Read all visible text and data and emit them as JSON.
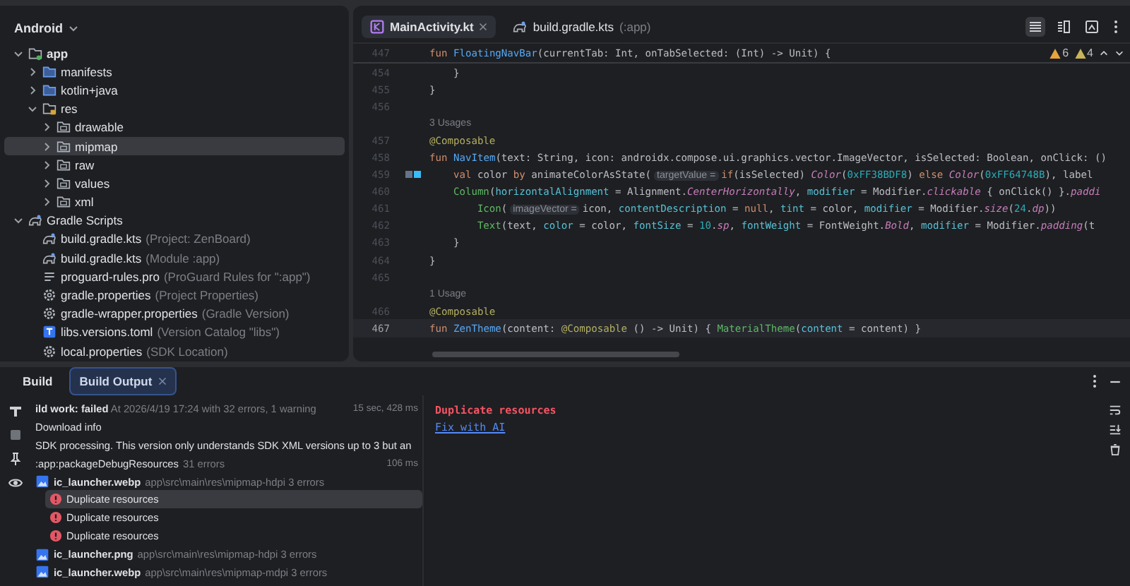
{
  "project_panel": {
    "title": "Android",
    "tree": [
      {
        "label": "app",
        "kind": "module",
        "expanded": true,
        "selected": false,
        "children": [
          {
            "label": "manifests",
            "kind": "folder",
            "expanded": false,
            "selected": false
          },
          {
            "label": "kotlin+java",
            "kind": "folder",
            "expanded": false,
            "selected": false
          },
          {
            "label": "res",
            "kind": "res",
            "expanded": true,
            "selected": false,
            "children": [
              {
                "label": "drawable",
                "kind": "subfolder",
                "expanded": false,
                "selected": false
              },
              {
                "label": "mipmap",
                "kind": "subfolder",
                "expanded": false,
                "selected": true
              },
              {
                "label": "raw",
                "kind": "subfolder",
                "expanded": false,
                "selected": false
              },
              {
                "label": "values",
                "kind": "subfolder",
                "expanded": false,
                "selected": false
              },
              {
                "label": "xml",
                "kind": "subfolder",
                "expanded": false,
                "selected": false
              }
            ]
          }
        ]
      },
      {
        "label": "Gradle Scripts",
        "kind": "gradle",
        "expanded": true,
        "selected": false,
        "children": [
          {
            "label": "build.gradle.kts",
            "hint": "(Project: ZenBoard)",
            "kind": "gradle",
            "selected": false
          },
          {
            "label": "build.gradle.kts",
            "hint": "(Module :app)",
            "kind": "gradle",
            "selected": false
          },
          {
            "label": "proguard-rules.pro",
            "hint": "(ProGuard Rules for \":app\")",
            "kind": "lines",
            "selected": false
          },
          {
            "label": "gradle.properties",
            "hint": "(Project Properties)",
            "kind": "gear",
            "selected": false
          },
          {
            "label": "gradle-wrapper.properties",
            "hint": "(Gradle Version)",
            "kind": "gear",
            "selected": false
          },
          {
            "label": "libs.versions.toml",
            "hint": "(Version Catalog \"libs\")",
            "kind": "toml",
            "selected": false
          },
          {
            "label": "local.properties",
            "hint": "(SDK Location)",
            "kind": "gear",
            "selected": false
          }
        ]
      }
    ]
  },
  "editor": {
    "tabs": [
      {
        "label": "MainActivity.kt",
        "kind": "kotlin",
        "selected": true,
        "closable": true
      },
      {
        "label": "build.gradle.kts",
        "hint": "(:app)",
        "kind": "gradle",
        "selected": false,
        "closable": false
      }
    ],
    "view_modes": [
      {
        "kind": "code",
        "selected": true
      },
      {
        "kind": "split",
        "selected": false
      },
      {
        "kind": "design",
        "selected": false
      }
    ],
    "warnings": [
      {
        "count": "6",
        "color": "#e8a33d"
      },
      {
        "count": "4",
        "color": "#c9b458"
      }
    ],
    "sticky_line": {
      "number": "447",
      "tokens": [
        {
          "kind": "kw",
          "text": "fun "
        },
        {
          "kind": "fn",
          "text": "FloatingNavBar"
        },
        {
          "kind": "t",
          "text": "(currentTab: Int, onTabSelected: (Int) -> Unit) {"
        }
      ]
    },
    "lines": [
      {
        "kind": "code",
        "number": "454",
        "current": false,
        "tokens": [
          {
            "kind": "t",
            "text": "    }"
          }
        ]
      },
      {
        "kind": "code",
        "number": "455",
        "current": false,
        "tokens": [
          {
            "kind": "t",
            "text": "}"
          }
        ]
      },
      {
        "kind": "code",
        "number": "456",
        "current": false
      },
      {
        "kind": "usages",
        "text": "3 Usages"
      },
      {
        "kind": "code",
        "number": "457",
        "current": false,
        "tokens": [
          {
            "kind": "ann",
            "text": "@Composable"
          }
        ]
      },
      {
        "kind": "code",
        "number": "458",
        "current": false,
        "tokens": [
          {
            "kind": "kw",
            "text": "fun "
          },
          {
            "kind": "fn",
            "text": "NavItem"
          },
          {
            "kind": "t",
            "text": "(text: String, icon: androidx.compose.ui.graphics.vector.ImageVector, isSelected: Boolean, onClick: ()"
          }
        ]
      },
      {
        "kind": "code",
        "number": "459",
        "current": false,
        "swatches": [
          {
            "color": "#64748b"
          },
          {
            "color": "#38bdf8"
          }
        ],
        "tokens": [
          {
            "kind": "kw",
            "text": "    val "
          },
          {
            "kind": "t",
            "text": "color "
          },
          {
            "kind": "kw",
            "text": "by "
          },
          {
            "kind": "t",
            "text": "animateColorAsState("
          },
          {
            "kind": "hint",
            "text": "targetValue ="
          },
          {
            "kind": "kw",
            "text": "if"
          },
          {
            "kind": "t",
            "text": "(isSelected) "
          },
          {
            "kind": "it",
            "text": "Color"
          },
          {
            "kind": "t",
            "text": "("
          },
          {
            "kind": "n",
            "text": "0xFF38BDF8"
          },
          {
            "kind": "t",
            "text": ") "
          },
          {
            "kind": "kw",
            "text": "else "
          },
          {
            "kind": "it",
            "text": "Color"
          },
          {
            "kind": "t",
            "text": "("
          },
          {
            "kind": "n",
            "text": "0xFF64748B"
          },
          {
            "kind": "t",
            "text": "), label"
          }
        ]
      },
      {
        "kind": "code",
        "number": "460",
        "current": false,
        "tokens": [
          {
            "kind": "call",
            "text": "    Column"
          },
          {
            "kind": "t",
            "text": "("
          },
          {
            "kind": "pn",
            "text": "horizontalAlignment"
          },
          {
            "kind": "t",
            "text": " = Alignment."
          },
          {
            "kind": "it",
            "text": "CenterHorizontally"
          },
          {
            "kind": "t",
            "text": ", "
          },
          {
            "kind": "pn",
            "text": "modifier"
          },
          {
            "kind": "t",
            "text": " = Modifier."
          },
          {
            "kind": "it",
            "text": "clickable"
          },
          {
            "kind": "t",
            "text": " { onClick() }."
          },
          {
            "kind": "it",
            "text": "paddi"
          }
        ]
      },
      {
        "kind": "code",
        "number": "461",
        "current": false,
        "tokens": [
          {
            "kind": "call",
            "text": "        Icon"
          },
          {
            "kind": "t",
            "text": "("
          },
          {
            "kind": "hint",
            "text": "imageVector ="
          },
          {
            "kind": "t",
            "text": "icon, "
          },
          {
            "kind": "pn",
            "text": "contentDescription"
          },
          {
            "kind": "t",
            "text": " = "
          },
          {
            "kind": "kw",
            "text": "null"
          },
          {
            "kind": "t",
            "text": ", "
          },
          {
            "kind": "pn",
            "text": "tint"
          },
          {
            "kind": "t",
            "text": " = color, "
          },
          {
            "kind": "pn",
            "text": "modifier"
          },
          {
            "kind": "t",
            "text": " = Modifier."
          },
          {
            "kind": "it",
            "text": "size"
          },
          {
            "kind": "t",
            "text": "("
          },
          {
            "kind": "n",
            "text": "24"
          },
          {
            "kind": "t",
            "text": "."
          },
          {
            "kind": "it",
            "text": "dp"
          },
          {
            "kind": "t",
            "text": "))"
          }
        ]
      },
      {
        "kind": "code",
        "number": "462",
        "current": false,
        "tokens": [
          {
            "kind": "call",
            "text": "        Text"
          },
          {
            "kind": "t",
            "text": "(text, "
          },
          {
            "kind": "pn",
            "text": "color"
          },
          {
            "kind": "t",
            "text": " = color, "
          },
          {
            "kind": "pn",
            "text": "fontSize"
          },
          {
            "kind": "t",
            "text": " = "
          },
          {
            "kind": "n",
            "text": "10"
          },
          {
            "kind": "t",
            "text": "."
          },
          {
            "kind": "it",
            "text": "sp"
          },
          {
            "kind": "t",
            "text": ", "
          },
          {
            "kind": "pn",
            "text": "fontWeight"
          },
          {
            "kind": "t",
            "text": " = FontWeight."
          },
          {
            "kind": "it",
            "text": "Bold"
          },
          {
            "kind": "t",
            "text": ", "
          },
          {
            "kind": "pn",
            "text": "modifier"
          },
          {
            "kind": "t",
            "text": " = Modifier."
          },
          {
            "kind": "it",
            "text": "padding"
          },
          {
            "kind": "t",
            "text": "(t"
          }
        ]
      },
      {
        "kind": "code",
        "number": "463",
        "current": false,
        "tokens": [
          {
            "kind": "t",
            "text": "    }"
          }
        ]
      },
      {
        "kind": "code",
        "number": "464",
        "current": false,
        "tokens": [
          {
            "kind": "t",
            "text": "}"
          }
        ]
      },
      {
        "kind": "code",
        "number": "465",
        "current": false
      },
      {
        "kind": "usages",
        "text": "1 Usage"
      },
      {
        "kind": "code",
        "number": "466",
        "current": false,
        "tokens": [
          {
            "kind": "ann",
            "text": "@Composable"
          }
        ]
      },
      {
        "kind": "code",
        "number": "467",
        "current": true,
        "tokens": [
          {
            "kind": "kw",
            "text": "fun "
          },
          {
            "kind": "fn",
            "text": "ZenTheme"
          },
          {
            "kind": "t",
            "text": "(content: "
          },
          {
            "kind": "ann",
            "text": "@Composable"
          },
          {
            "kind": "t",
            "text": " () -> Unit) { "
          },
          {
            "kind": "call",
            "text": "MaterialTheme"
          },
          {
            "kind": "t",
            "text": "("
          },
          {
            "kind": "pn",
            "text": "content"
          },
          {
            "kind": "t",
            "text": " = content) }"
          }
        ]
      }
    ]
  },
  "build_panel": {
    "tabs": [
      {
        "label": "Build",
        "selected": false,
        "closable": false
      },
      {
        "label": "Build Output",
        "selected": true,
        "closable": true
      }
    ],
    "rows": [
      {
        "kind": "summary",
        "title": "ild work: failed",
        "detail": "At 2026/4/19 17:24 with 32 errors, 1 warning",
        "time": "15 sec, 428 ms"
      },
      {
        "kind": "info",
        "title": "Download info"
      },
      {
        "kind": "info",
        "title": "SDK processing. This version only understands SDK XML versions up to 3 but an"
      },
      {
        "kind": "task",
        "title": ":app:packageDebugResources",
        "detail": "31 errors",
        "time": "106 ms"
      },
      {
        "kind": "file",
        "title": "ic_launcher.webp",
        "path": "app\\src\\main\\res\\mipmap-hdpi",
        "detail": "3 errors",
        "children": [
          {
            "kind": "error",
            "title": "Duplicate resources",
            "selected": true
          },
          {
            "kind": "error",
            "title": "Duplicate resources",
            "selected": false
          },
          {
            "kind": "error",
            "title": "Duplicate resources",
            "selected": false
          }
        ]
      },
      {
        "kind": "file",
        "title": "ic_launcher.png",
        "path": "app\\src\\main\\res\\mipmap-hdpi",
        "detail": "3 errors"
      },
      {
        "kind": "file",
        "title": "ic_launcher.webp",
        "path": "app\\src\\main\\res\\mipmap-mdpi",
        "detail": "3 errors"
      }
    ],
    "console": {
      "message": "Duplicate resources",
      "link": "Fix with AI"
    }
  }
}
